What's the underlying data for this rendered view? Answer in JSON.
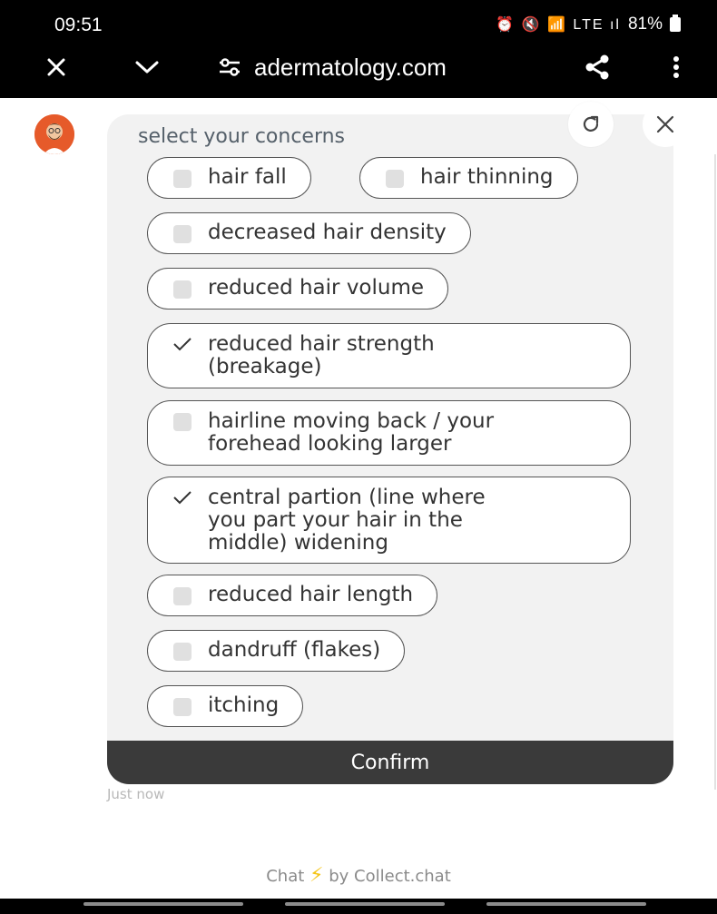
{
  "status": {
    "time": "09:51",
    "battery": "81%",
    "icons": "⏰ 🔇 📶 LTE ıl"
  },
  "browser": {
    "url": "adermatology.com"
  },
  "chat": {
    "prompt": "select your concerns",
    "options": [
      {
        "label": "hair fall",
        "checked": false
      },
      {
        "label": "hair thinning",
        "checked": false
      },
      {
        "label": "decreased hair density",
        "checked": false
      },
      {
        "label": "reduced hair volume",
        "checked": false
      },
      {
        "label_lines": [
          "reduced hair strength",
          "(breakage)"
        ],
        "checked": true
      },
      {
        "label_lines": [
          "hairline moving back / your",
          "forehead looking larger"
        ],
        "checked": false
      },
      {
        "label_lines": [
          "central partion (line where",
          "you part your hair in the",
          "middle) widening"
        ],
        "checked": true
      },
      {
        "label": "reduced hair length",
        "checked": false
      },
      {
        "label": "dandruff (flakes)",
        "checked": false
      },
      {
        "label": "itching",
        "checked": false
      }
    ],
    "confirm_label": "Confirm",
    "timestamp": "Just now"
  },
  "footer": {
    "prefix": "Chat",
    "suffix": "by Collect.chat"
  },
  "colors": {
    "accent": "#3a3a3a",
    "avatar": "#e65a2a",
    "bolt": "#f5c518"
  }
}
